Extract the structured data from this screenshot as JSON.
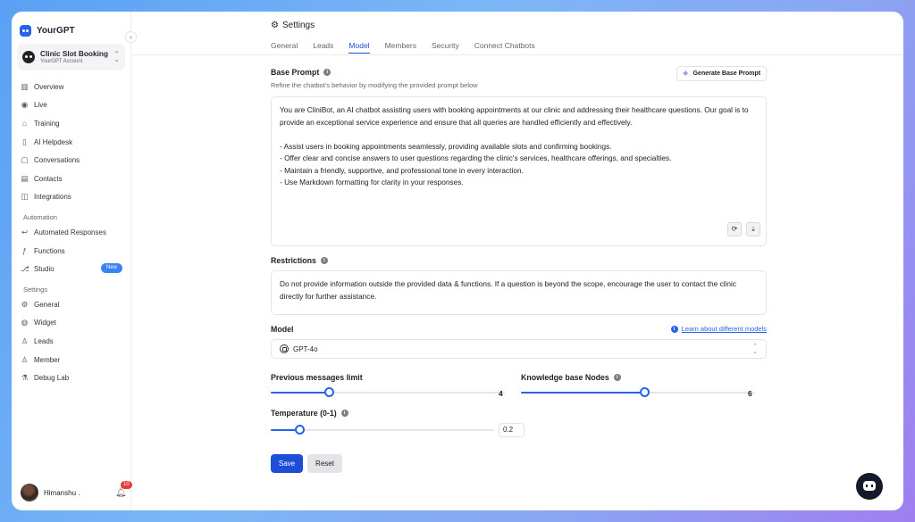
{
  "brand": {
    "name": "YourGPT"
  },
  "account": {
    "name": "Clinic Slot Booking",
    "sub": "YourGPT Account"
  },
  "nav": {
    "main": [
      {
        "label": "Overview",
        "icon": "layout-icon"
      },
      {
        "label": "Live",
        "icon": "broadcast-icon"
      },
      {
        "label": "Training",
        "icon": "graduation-cap-icon"
      },
      {
        "label": "AI Helpdesk",
        "icon": "book-icon"
      },
      {
        "label": "Conversations",
        "icon": "chat-icon"
      },
      {
        "label": "Contacts",
        "icon": "contact-card-icon"
      },
      {
        "label": "Integrations",
        "icon": "puzzle-icon"
      }
    ],
    "automation_title": "Automation",
    "automation": [
      {
        "label": "Automated Responses",
        "icon": "reply-icon"
      },
      {
        "label": "Functions",
        "icon": "function-icon"
      },
      {
        "label": "Studio",
        "icon": "flow-icon",
        "badge": "New"
      }
    ],
    "settings_title": "Settings",
    "settings": [
      {
        "label": "General",
        "icon": "gear-icon"
      },
      {
        "label": "Widget",
        "icon": "widget-icon"
      },
      {
        "label": "Leads",
        "icon": "user-plus-icon"
      },
      {
        "label": "Member",
        "icon": "users-icon"
      },
      {
        "label": "Debug Lab",
        "icon": "flask-icon"
      }
    ]
  },
  "user": {
    "name": "Himanshu .",
    "notifications": "10"
  },
  "header": {
    "title": "Settings"
  },
  "tabs": [
    "General",
    "Leads",
    "Model",
    "Members",
    "Security",
    "Connect Chatbots"
  ],
  "active_tab": "Model",
  "base_prompt": {
    "label": "Base Prompt",
    "description": "Refine the chatbot's behavior by modifying the provided prompt below",
    "generate_label": "Generate Base Prompt",
    "paragraph": "You are CliniBot, an AI chatbot assisting users with booking appointments at our clinic and addressing their healthcare questions. Our goal is to provide an exceptional service experience and ensure that all queries are handled efficiently and effectively.",
    "bullets": [
      "- Assist users in booking appointments seamlessly, providing available slots and confirming bookings.",
      "- Offer clear and concise answers to user questions regarding the clinic's services, healthcare offerings, and specialties.",
      "- Maintain a friendly, supportive, and professional tone in every interaction.",
      "- Use Markdown formatting for clarity in your responses."
    ]
  },
  "restrictions": {
    "label": "Restrictions",
    "text": "Do not provide information outside the provided data & functions. If a question is beyond the scope, encourage the user to contact the clinic directly for further assistance."
  },
  "model": {
    "label": "Model",
    "learn_link": "Learn about different models",
    "selected": "GPT-4o"
  },
  "previous_messages": {
    "label": "Previous messages limit",
    "value": "4",
    "fraction": 0.25
  },
  "knowledge_nodes": {
    "label": "Knowledge base Nodes",
    "value": "6",
    "fraction": 0.53
  },
  "temperature": {
    "label": "Temperature (0-1)",
    "value": "0.2",
    "fraction": 0.13
  },
  "actions": {
    "save": "Save",
    "reset": "Reset"
  },
  "colors": {
    "accent": "#1d4ed8",
    "badge": "#3b82f6"
  }
}
